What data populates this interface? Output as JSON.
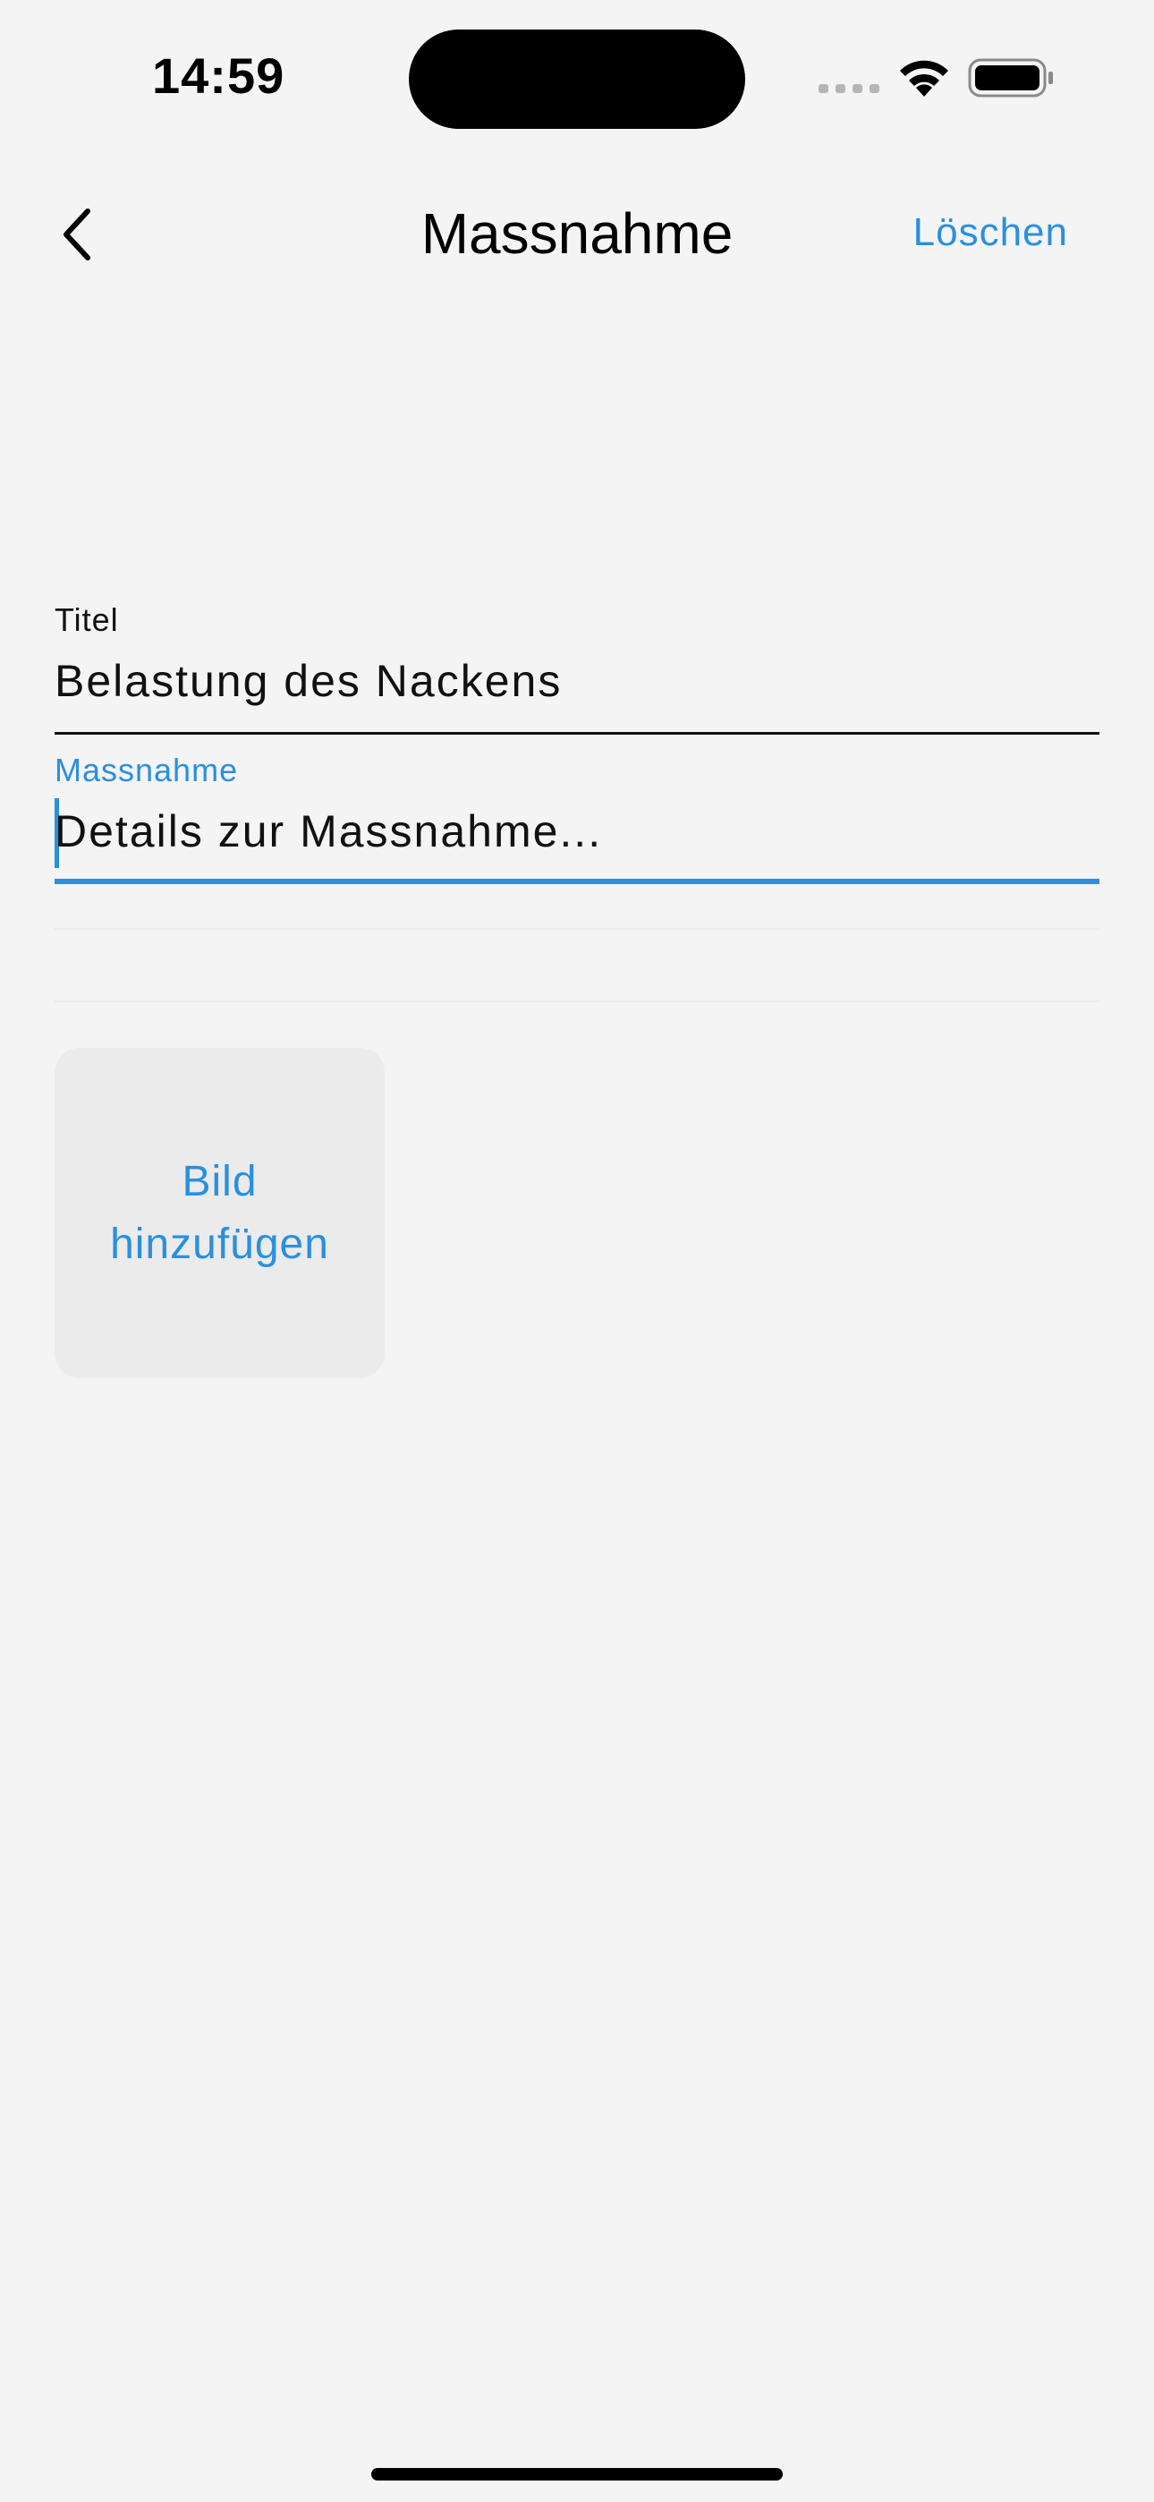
{
  "status_bar": {
    "time": "14:59",
    "icons": [
      "signal-dots-icon",
      "wifi-icon",
      "battery-icon"
    ]
  },
  "nav": {
    "back_icon": "chevron-left-icon",
    "title": "Massnahme",
    "delete_label": "Löschen"
  },
  "form": {
    "title_field": {
      "label": "Titel",
      "value": "Belastung des Nackens"
    },
    "measure_field": {
      "label": "Massnahme",
      "placeholder": "Details zur Massnahme..."
    }
  },
  "add_image": {
    "label": "Bild hinzufügen"
  },
  "colors": {
    "accent": "#2a8fdf",
    "background": "#f4f4f4",
    "tile": "#ebebeb",
    "text": "#111111"
  }
}
